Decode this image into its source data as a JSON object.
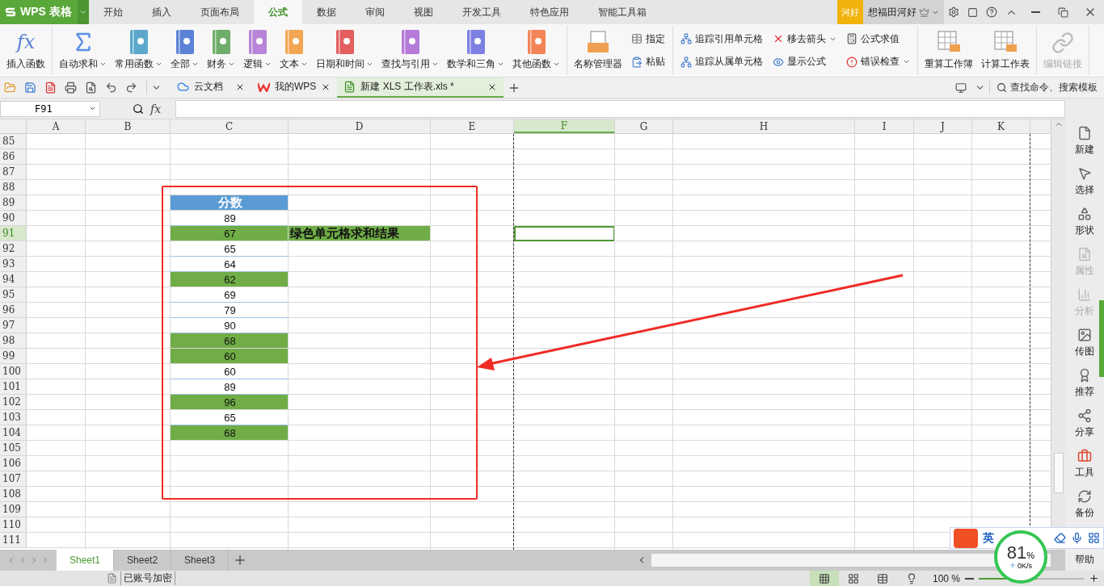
{
  "app_button": {
    "label": "WPS 表格"
  },
  "menu_tabs": [
    {
      "label": "开始",
      "selected": false
    },
    {
      "label": "插入",
      "selected": false
    },
    {
      "label": "页面布局",
      "selected": false
    },
    {
      "label": "公式",
      "selected": true
    },
    {
      "label": "数据",
      "selected": false
    },
    {
      "label": "审阅",
      "selected": false
    },
    {
      "label": "视图",
      "selected": false
    },
    {
      "label": "开发工具",
      "selected": false
    },
    {
      "label": "特色应用",
      "selected": false
    },
    {
      "label": "智能工具箱",
      "selected": false
    }
  ],
  "user": {
    "badge": "河好",
    "name": "想福田河好"
  },
  "ribbon_groups": [
    {
      "items": [
        {
          "kind": "function",
          "icon_text": "fx",
          "label": "插入函数",
          "dropdown": false,
          "disabled": false
        }
      ]
    },
    {
      "items": [
        {
          "kind": "sum",
          "label": "自动求和",
          "dropdown": true,
          "disabled": false
        },
        {
          "kind": "category",
          "color": "#5ba8cc",
          "label": "常用函数",
          "dropdown": true,
          "disabled": false
        },
        {
          "kind": "category",
          "color": "#5b82d6",
          "label": "全部",
          "dropdown": true,
          "disabled": false
        },
        {
          "kind": "category",
          "color": "#6fad6a",
          "label": "财务",
          "dropdown": true,
          "disabled": false
        },
        {
          "kind": "category",
          "color": "#b985d8",
          "label": "逻辑",
          "dropdown": true,
          "disabled": false
        },
        {
          "kind": "category",
          "color": "#f2a552",
          "label": "文本",
          "dropdown": true,
          "disabled": false
        },
        {
          "kind": "category",
          "color": "#e35f5f",
          "label": "日期和时间",
          "dropdown": true,
          "disabled": false
        },
        {
          "kind": "category",
          "color": "#b67ad9",
          "label": "查找与引用",
          "dropdown": true,
          "disabled": false
        },
        {
          "kind": "category",
          "color": "#7d80e2",
          "label": "数学和三角",
          "dropdown": true,
          "disabled": false
        },
        {
          "kind": "category",
          "color": "#f38458",
          "label": "其他函数",
          "dropdown": true,
          "disabled": false
        }
      ]
    },
    {
      "items": [
        {
          "kind": "names",
          "label": "名称管理器",
          "dropdown": false,
          "disabled": false
        },
        {
          "kind": "stack",
          "rows": [
            {
              "kind": "table",
              "label": "指定",
              "dropdown": false
            },
            {
              "kind": "paste",
              "label": "粘贴",
              "dropdown": false
            }
          ]
        }
      ]
    },
    {
      "items": [
        {
          "kind": "stack",
          "rows": [
            {
              "kind": "trace",
              "label": "追踪引用单元格",
              "dropdown": false
            },
            {
              "kind": "trace",
              "label": "追踪从属单元格",
              "dropdown": false
            }
          ]
        },
        {
          "kind": "stack",
          "rows": [
            {
              "kind": "remove",
              "label": "移去箭头",
              "dropdown": true
            },
            {
              "kind": "show",
              "label": "显示公式",
              "dropdown": false
            }
          ]
        },
        {
          "kind": "stack",
          "rows": [
            {
              "kind": "evaluate",
              "label": "公式求值",
              "dropdown": false
            },
            {
              "kind": "error",
              "label": "错误检查",
              "dropdown": true
            }
          ]
        }
      ]
    },
    {
      "items": [
        {
          "kind": "recalc",
          "label": "重算工作簿",
          "dropdown": false,
          "disabled": false
        },
        {
          "kind": "recalc",
          "label": "计算工作表",
          "dropdown": false,
          "disabled": false
        }
      ]
    },
    {
      "items": [
        {
          "kind": "link",
          "label": "编辑链接",
          "dropdown": false,
          "disabled": true
        }
      ]
    }
  ],
  "doc_tabs": [
    {
      "kind": "cloud",
      "label": "云文档",
      "selected": false
    },
    {
      "kind": "wps",
      "label": "我的WPS",
      "selected": false
    },
    {
      "kind": "sheet",
      "label": "新建 XLS 工作表.xls *",
      "selected": true
    }
  ],
  "search": {
    "placeholder": "查找命令、搜索模板"
  },
  "formula_bar": {
    "name_box": "F91",
    "fx": "fx"
  },
  "sheet": {
    "columns": [
      {
        "label": "A",
        "selected": false
      },
      {
        "label": "B",
        "selected": false
      },
      {
        "label": "C",
        "selected": false
      },
      {
        "label": "D",
        "selected": false
      },
      {
        "label": "E",
        "selected": false
      },
      {
        "label": "F",
        "selected": true
      },
      {
        "label": "G",
        "selected": false
      },
      {
        "label": "H",
        "selected": false
      },
      {
        "label": "I",
        "selected": false
      },
      {
        "label": "J",
        "selected": false
      },
      {
        "label": "K",
        "selected": false
      }
    ],
    "rows": [
      {
        "label": "85",
        "selected": false
      },
      {
        "label": "86",
        "selected": false
      },
      {
        "label": "87",
        "selected": false
      },
      {
        "label": "88",
        "selected": false
      },
      {
        "label": "89",
        "selected": false,
        "cells": {
          "column_3": {
            "text": "分数",
            "kind": "header"
          }
        }
      },
      {
        "label": "90",
        "selected": false,
        "cells": {
          "column_3": {
            "text": "89",
            "kind": "plain"
          }
        }
      },
      {
        "label": "91",
        "selected": true,
        "cells": {
          "column_3": {
            "text": "67",
            "kind": "green"
          },
          "column_4": {
            "text": "绿色单元格求和结果",
            "kind": "result"
          }
        }
      },
      {
        "label": "92",
        "selected": false,
        "cells": {
          "column_3": {
            "text": "65",
            "kind": "plain"
          }
        }
      },
      {
        "label": "93",
        "selected": false,
        "cells": {
          "column_3": {
            "text": "64",
            "kind": "plain"
          }
        }
      },
      {
        "label": "94",
        "selected": false,
        "cells": {
          "column_3": {
            "text": "62",
            "kind": "green"
          }
        }
      },
      {
        "label": "95",
        "selected": false,
        "cells": {
          "column_3": {
            "text": "69",
            "kind": "plain"
          }
        }
      },
      {
        "label": "96",
        "selected": false,
        "cells": {
          "column_3": {
            "text": "79",
            "kind": "plain"
          }
        }
      },
      {
        "label": "97",
        "selected": false,
        "cells": {
          "column_3": {
            "text": "90",
            "kind": "plain"
          }
        }
      },
      {
        "label": "98",
        "selected": false,
        "cells": {
          "column_3": {
            "text": "68",
            "kind": "green"
          }
        }
      },
      {
        "label": "99",
        "selected": false,
        "cells": {
          "column_3": {
            "text": "60",
            "kind": "green"
          }
        }
      },
      {
        "label": "100",
        "selected": false,
        "cells": {
          "column_3": {
            "text": "60",
            "kind": "plain"
          }
        }
      },
      {
        "label": "101",
        "selected": false,
        "cells": {
          "column_3": {
            "text": "89",
            "kind": "plain"
          }
        }
      },
      {
        "label": "102",
        "selected": false,
        "cells": {
          "column_3": {
            "text": "96",
            "kind": "green"
          }
        }
      },
      {
        "label": "103",
        "selected": false,
        "cells": {
          "column_3": {
            "text": "65",
            "kind": "plain"
          }
        }
      },
      {
        "label": "104",
        "selected": false,
        "cells": {
          "column_3": {
            "text": "68",
            "kind": "green"
          }
        }
      },
      {
        "label": "105",
        "selected": false
      },
      {
        "label": "106",
        "selected": false
      },
      {
        "label": "107",
        "selected": false
      },
      {
        "label": "108",
        "selected": false
      },
      {
        "label": "109",
        "selected": false
      },
      {
        "label": "110",
        "selected": false
      },
      {
        "label": "111",
        "selected": false
      }
    ]
  },
  "sheet_tabs": [
    {
      "label": "Sheet1",
      "selected": true
    },
    {
      "label": "Sheet2",
      "selected": false
    },
    {
      "label": "Sheet3",
      "selected": false
    }
  ],
  "sidebar": [
    {
      "kind": "file",
      "label": "新建",
      "disabled": false
    },
    {
      "kind": "select",
      "label": "选择",
      "disabled": false
    },
    {
      "kind": "shape",
      "label": "形状",
      "disabled": false
    },
    {
      "kind": "properties",
      "label": "属性",
      "disabled": true
    },
    {
      "kind": "analyze",
      "label": "分析",
      "disabled": true
    },
    {
      "kind": "image",
      "label": "传图",
      "disabled": false
    },
    {
      "kind": "recommend",
      "label": "推荐",
      "disabled": false
    },
    {
      "kind": "share",
      "label": "分享",
      "disabled": false
    },
    {
      "kind": "tools",
      "label": "工具",
      "disabled": false
    },
    {
      "kind": "backup",
      "label": "备份",
      "disabled": false
    },
    {
      "kind": "help",
      "label": "帮助",
      "disabled": false
    }
  ],
  "status_bar": {
    "account": "已账号加密",
    "zoom": "100 %",
    "zoom_slider": {
      "level": 0.55
    }
  },
  "ime_bar": {
    "mode": "英"
  },
  "net_meter": {
    "value": "81",
    "unit": "%",
    "speed": "0K/s"
  }
}
